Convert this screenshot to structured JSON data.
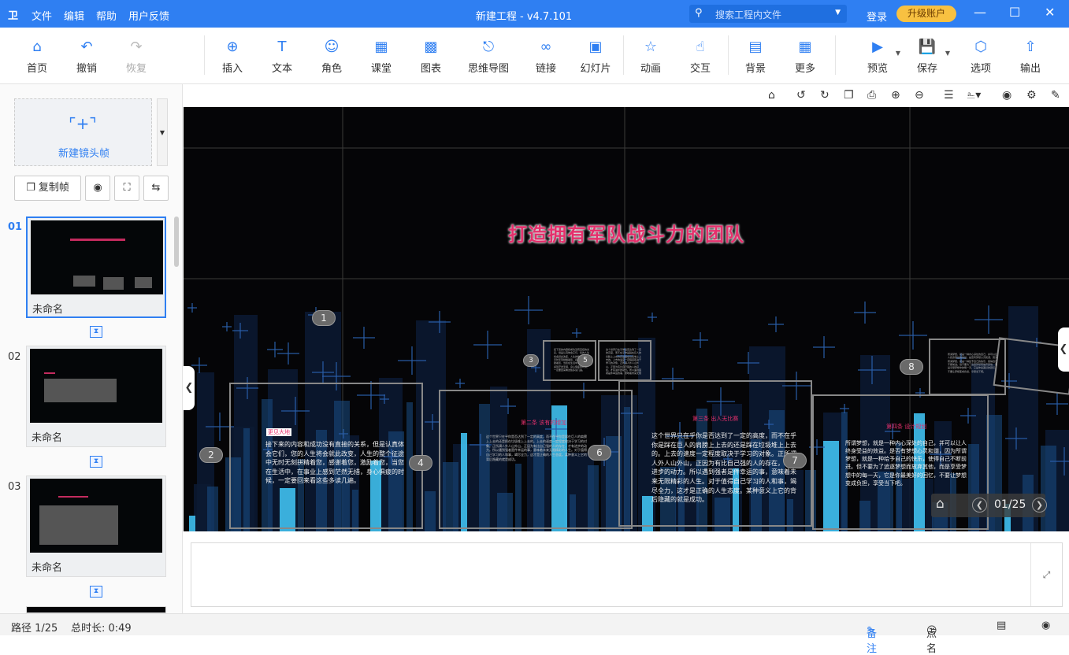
{
  "titlebar": {
    "logo": "卫",
    "menu": [
      "文件",
      "编辑",
      "帮助",
      "用户反馈"
    ],
    "title": "新建工程 - v4.7.101",
    "search_placeholder": "搜索工程内文件",
    "login": "登录",
    "upgrade": "升级账户",
    "colors": {
      "bar": "#2f7ff2",
      "upgrade": "#f8c141"
    }
  },
  "toolbar": {
    "home": "首页",
    "undo": "撤销",
    "redo": "恢复",
    "insert": "插入",
    "text": "文本",
    "role": "角色",
    "classroom": "课堂",
    "chart": "图表",
    "mindmap": "思维导图",
    "link": "链接",
    "slideshow": "幻灯片",
    "animation": "动画",
    "interaction": "交互",
    "background": "背景",
    "more": "更多",
    "preview": "预览",
    "save": "保存",
    "options": "选项",
    "export": "输出"
  },
  "sidebar": {
    "new_frame": "新建镜头帧",
    "copy_frame": "复制帧",
    "slides": [
      {
        "num": "01",
        "caption": "未命名",
        "active": true
      },
      {
        "num": "02",
        "caption": "未命名",
        "active": false
      },
      {
        "num": "03",
        "caption": "未命名",
        "active": false
      }
    ]
  },
  "stage": {
    "headline": "打造拥有军队战斗力的团队",
    "markers": [
      "1",
      "2",
      "3",
      "4",
      "5",
      "6",
      "7",
      "8"
    ],
    "section_titles": [
      "更见大地",
      "第二条 该有的增加",
      "第三条 出人无比赛",
      "第四条 设计规划"
    ],
    "paragraph_1": "接下来的内容和成功没有直接的关系，但是认真体会它们，您的人生将会就此改变，人生的整个征途中无时无刻拼精着您，感谢着您，激励着您，当您在生活中，在事业上感到茫然无措，身心俱疲的时候，一定要回来看这些多读几遍。",
    "paragraph_2": "这个世界只在乎你是否达到了一定的高度，而不在乎你是踩在巨人的肩膀上上去的还是踩在垃圾堆上上去的。上去的速度一定程度取决于学习的对象。正所谓人外人山外山，正因为有比自己强的人的存在，才有进步的动力。所以遇到强者是件幸运的事，意味着未来无限精彩的人生。对于值得自己学习的人和事，竭尽全力，这才是正确的人生态度。某种意义上它的背后隐藏的就是成功。",
    "paragraph_3": "所谓梦想，就是一种内心深处的自己，并可以让人终身受益的效益。是否有梦想心灵和谐，因为所谓梦想，就是一种给予自己的快乐，使得自己不断前进。但不要为了追逐梦想而放弃其他，而是享受梦想中的每一天，它是你最美好的回忆，不要让梦想变成负担，享受当下吧。",
    "pager": "01/25"
  },
  "status": {
    "path": "路径 1/25",
    "duration": "总时长: 0:49",
    "notes": "备注",
    "rollcall": "点名"
  }
}
